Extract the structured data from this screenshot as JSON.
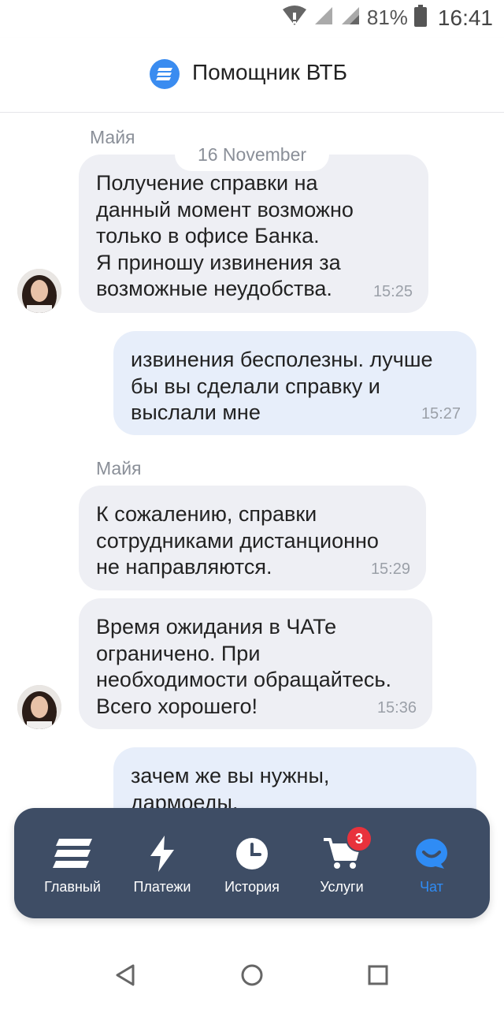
{
  "status_bar": {
    "battery": "81%",
    "time": "16:41"
  },
  "header": {
    "title": "Помощник ВТБ"
  },
  "chat": {
    "date": "16 November",
    "messages": [
      {
        "sender": "Майя",
        "text": "Получение справки на\nданный момент возможно\nтолько в офисе Банка.\nЯ приношу извинения за\nвозможные неудобства.",
        "time": "15:25"
      },
      {
        "text": "извинения бесполезны. лучше\nбы вы сделали справку и\nвыслали мне",
        "time": "15:27"
      },
      {
        "sender": "Майя",
        "text": "К сожалению, справки\nсотрудниками дистанционно\nне направляются.",
        "time": "15:29"
      },
      {
        "text": "Время ожидания в ЧАТе\nограничено. При\nнеобходимости обращайтесь.\nВсего хорошего!",
        "time": "15:36"
      },
      {
        "text": "зачем же вы нужны,\nдармоеды."
      }
    ]
  },
  "nav": {
    "items": [
      {
        "label": "Главный",
        "icon": "menu-lines-icon"
      },
      {
        "label": "Платежи",
        "icon": "lightning-icon"
      },
      {
        "label": "История",
        "icon": "clock-icon"
      },
      {
        "label": "Услуги",
        "icon": "cart-icon",
        "badge": "3"
      },
      {
        "label": "Чат",
        "icon": "chat-bubble-icon",
        "active": true
      }
    ]
  },
  "colors": {
    "accent": "#2f8cf5",
    "nav_bg": "#3e4d65",
    "bubble_in": "#eeeff4",
    "bubble_out": "#e7eefa",
    "badge": "#e8323c"
  }
}
